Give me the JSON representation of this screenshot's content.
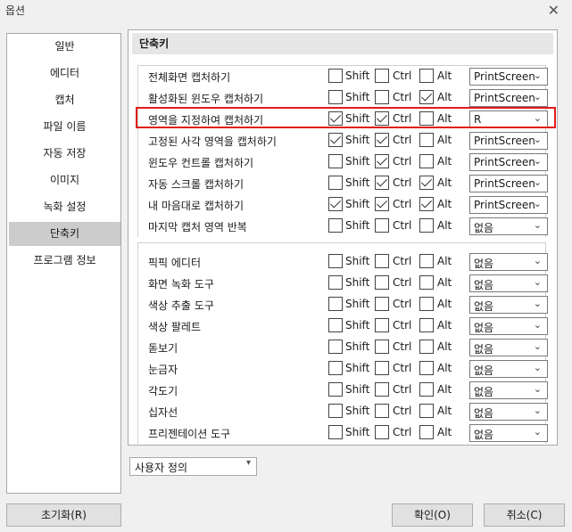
{
  "window": {
    "title": "옵션",
    "close_glyph": "✕"
  },
  "sidebar": {
    "items": [
      {
        "label": "일반"
      },
      {
        "label": "에디터"
      },
      {
        "label": "캡처"
      },
      {
        "label": "파일 이름"
      },
      {
        "label": "자동 저장"
      },
      {
        "label": "이미지"
      },
      {
        "label": "녹화 설정"
      },
      {
        "label": "단축키"
      },
      {
        "label": "프로그램 정보"
      }
    ],
    "selected_index": 7
  },
  "panel": {
    "header": "단축키"
  },
  "modifiers": {
    "shift": "Shift",
    "ctrl": "Ctrl",
    "alt": "Alt"
  },
  "section1": [
    {
      "label": "전체화면 캡처하기",
      "shift": false,
      "ctrl": false,
      "alt": false,
      "key": "PrintScreen"
    },
    {
      "label": "활성화된 윈도우 캡처하기",
      "shift": false,
      "ctrl": false,
      "alt": true,
      "key": "PrintScreen"
    },
    {
      "label": "영역을 지정하여 캡처하기",
      "shift": true,
      "ctrl": true,
      "alt": false,
      "key": "R"
    },
    {
      "label": "고정된 사각 영역을 캡처하기",
      "shift": true,
      "ctrl": true,
      "alt": false,
      "key": "PrintScreen"
    },
    {
      "label": "윈도우 컨트롤 캡처하기",
      "shift": false,
      "ctrl": true,
      "alt": false,
      "key": "PrintScreen"
    },
    {
      "label": "자동 스크롤 캡처하기",
      "shift": false,
      "ctrl": true,
      "alt": true,
      "key": "PrintScreen"
    },
    {
      "label": "내 마음대로 캡처하기",
      "shift": true,
      "ctrl": true,
      "alt": true,
      "key": "PrintScreen"
    },
    {
      "label": "마지막 캡처 영역 반복",
      "shift": false,
      "ctrl": false,
      "alt": false,
      "key": "없음"
    }
  ],
  "section2": [
    {
      "label": "픽픽 에디터",
      "shift": false,
      "ctrl": false,
      "alt": false,
      "key": "없음"
    },
    {
      "label": "화면 녹화 도구",
      "shift": false,
      "ctrl": false,
      "alt": false,
      "key": "없음"
    },
    {
      "label": "색상 추출 도구",
      "shift": false,
      "ctrl": false,
      "alt": false,
      "key": "없음"
    },
    {
      "label": "색상 팔레트",
      "shift": false,
      "ctrl": false,
      "alt": false,
      "key": "없음"
    },
    {
      "label": "돋보기",
      "shift": false,
      "ctrl": false,
      "alt": false,
      "key": "없음"
    },
    {
      "label": "눈금자",
      "shift": false,
      "ctrl": false,
      "alt": false,
      "key": "없음"
    },
    {
      "label": "각도기",
      "shift": false,
      "ctrl": false,
      "alt": false,
      "key": "없음"
    },
    {
      "label": "십자선",
      "shift": false,
      "ctrl": false,
      "alt": false,
      "key": "없음"
    },
    {
      "label": "프리젠테이션 도구",
      "shift": false,
      "ctrl": false,
      "alt": false,
      "key": "없음"
    }
  ],
  "preset": {
    "value": "사용자 정의"
  },
  "buttons": {
    "reset": "초기화(R)",
    "ok": "확인(O)",
    "cancel": "취소(C)"
  },
  "colors": {
    "highlight": "#e01b1b",
    "selected_item_bg": "#cccccc"
  }
}
